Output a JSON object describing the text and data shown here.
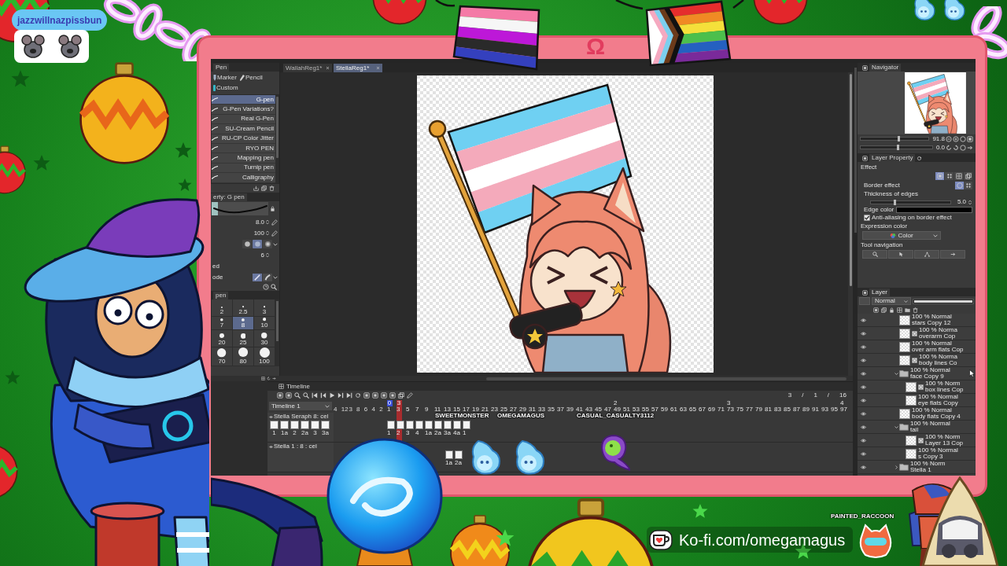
{
  "chat_badge": {
    "username": "jazzwillnazpissbun"
  },
  "banner": {
    "symbol": "Ω"
  },
  "canvas_tabs": [
    {
      "label": "WallahReg1*",
      "selected": false
    },
    {
      "label": "StellaReg1*",
      "selected": true
    }
  ],
  "tool_panel": {
    "tab": "Pen",
    "groups": [
      {
        "label": "Marker",
        "kind": "marker"
      },
      {
        "label": "Pencil",
        "kind": "pencil"
      },
      {
        "label": "Custom",
        "kind": "custom"
      }
    ],
    "brushes": [
      {
        "label": "G-pen",
        "selected": true
      },
      {
        "label": "G-Pen Variations?",
        "selected": false
      },
      {
        "label": "Real G-Pen",
        "selected": false
      },
      {
        "label": "SU-Cream Pencil",
        "selected": false
      },
      {
        "label": "RU-CP Color Jitter",
        "selected": false
      },
      {
        "label": "RYO PEN",
        "selected": false
      },
      {
        "label": "Mapping pen",
        "selected": false
      },
      {
        "label": "Turnip pen",
        "selected": false
      },
      {
        "label": "Calligraphy",
        "selected": false
      }
    ]
  },
  "tool_property": {
    "title": "erty: G pen",
    "rows": [
      {
        "kind": "slider",
        "value": "8.0"
      },
      {
        "kind": "slider",
        "value": "100"
      },
      {
        "kind": "tips",
        "options": [
          {
            "kind": "hard",
            "selected": false
          },
          {
            "kind": "soft",
            "selected": true
          },
          {
            "kind": "blur",
            "selected": false
          }
        ]
      },
      {
        "kind": "number",
        "value": "6"
      },
      {
        "kind": "label",
        "label": "ed"
      },
      {
        "kind": "mode",
        "label": "ode",
        "options": [
          {
            "kind": "pen",
            "selected": true
          },
          {
            "kind": "brush",
            "selected": false
          }
        ]
      }
    ]
  },
  "brush_size": {
    "tab": "pen",
    "sizes": [
      {
        "label": "2",
        "selected": false
      },
      {
        "label": "2.5",
        "selected": false
      },
      {
        "label": "3",
        "selected": false
      },
      {
        "label": "7",
        "selected": false
      },
      {
        "label": "8",
        "selected": true
      },
      {
        "label": "10",
        "selected": false
      },
      {
        "label": "20",
        "selected": false
      },
      {
        "label": "25",
        "selected": false
      },
      {
        "label": "30",
        "selected": false
      },
      {
        "label": "70",
        "selected": false
      },
      {
        "label": "80",
        "selected": false
      },
      {
        "label": "100",
        "selected": false
      }
    ]
  },
  "navigator": {
    "title": "Navigator",
    "zoom": {
      "value": "91.8",
      "level": 0.56
    },
    "rotation": {
      "value": "0.0",
      "level": 0.52
    }
  },
  "layer_property": {
    "title": "Layer Property",
    "section": "Effect",
    "effects": [
      {
        "kind": "border",
        "selected": true
      },
      {
        "kind": "tone",
        "selected": false
      },
      {
        "kind": "pattern",
        "selected": false
      },
      {
        "kind": "extract",
        "selected": false
      }
    ],
    "border_effect": {
      "label": "Border effect",
      "options": [
        {
          "kind": "edge",
          "selected": true
        },
        {
          "kind": "watercolor",
          "selected": false
        }
      ]
    },
    "thickness": {
      "label": "Thickness of edges",
      "value": "5.0",
      "level": 0.3
    },
    "edge_color": {
      "label": "Edge color",
      "color": "#000000"
    },
    "antialias": {
      "label": "Anti-aliasing on border effect",
      "checked": true
    },
    "expression_color": {
      "label": "Expression color",
      "value": "Color"
    },
    "tool_navigation": {
      "label": "Tool navigation",
      "buttons": [
        {
          "kind": "zoom"
        },
        {
          "kind": "object"
        },
        {
          "kind": "points"
        },
        {
          "kind": "arrow"
        }
      ]
    }
  },
  "layer_panel": {
    "tabs": [
      {
        "label": "Layer",
        "selected": true
      }
    ],
    "blend_mode": "Normal",
    "opacity": {
      "level": 1
    },
    "layers": [
      {
        "kind": "raster",
        "mode": "100 % Normal",
        "name": "stars Copy 12"
      },
      {
        "kind": "vector",
        "mode": "100 % Norma",
        "name": "overarm Cop"
      },
      {
        "kind": "raster",
        "mode": "100 % Normal",
        "name": "over arm flats Cop"
      },
      {
        "kind": "vector",
        "mode": "100 % Norma",
        "name": "body lines Co"
      },
      {
        "kind": "folder",
        "mode": "100 % Normal",
        "name": "face Copy 9",
        "expanded": true,
        "children": [
          {
            "kind": "vector",
            "mode": "100 % Norm",
            "name": "box lines Cop"
          },
          {
            "kind": "raster",
            "mode": "100 % Normal",
            "name": "eye flats Copy"
          }
        ]
      },
      {
        "kind": "raster",
        "mode": "100 % Normal",
        "name": "body flats Copy 4"
      },
      {
        "kind": "folder",
        "mode": "100 % Normal",
        "name": "tail",
        "expanded": true,
        "children": [
          {
            "kind": "vector",
            "mode": "100 % Norm",
            "name": "Layer 13 Cop"
          },
          {
            "kind": "raster",
            "mode": "100 % Normal",
            "name": "s Copy 3"
          }
        ]
      },
      {
        "kind": "folder",
        "mode": "100 % Norm",
        "name": "Stella 1",
        "expanded": false
      }
    ]
  },
  "timeline": {
    "title": "Timeline",
    "name": "Timeline 1",
    "counter": [
      "3",
      "/",
      "1",
      "/",
      "16"
    ],
    "ruler_marks": [
      {
        "label": "0",
        "kind": "in"
      },
      {
        "label": "3",
        "kind": "playhead"
      },
      {
        "label": "2",
        "kind": "second"
      },
      {
        "label": "3",
        "kind": "second"
      },
      {
        "label": "4",
        "kind": "second"
      }
    ],
    "lead_numbers": [
      "4",
      "12",
      "3",
      "8",
      "6",
      "4",
      "2"
    ],
    "frame_numbers": [
      "1",
      "3",
      "5",
      "7",
      "9",
      "11",
      "13",
      "15",
      "17",
      "19",
      "21",
      "23",
      "25",
      "27",
      "29",
      "31",
      "33",
      "35",
      "37",
      "39",
      "41",
      "43",
      "45",
      "47",
      "49",
      "51",
      "53",
      "55",
      "57",
      "59",
      "61",
      "63",
      "65",
      "67",
      "69",
      "71",
      "73",
      "75",
      "77",
      "79",
      "81",
      "83",
      "85",
      "87",
      "89",
      "91",
      "93",
      "95",
      "97"
    ],
    "tracks": [
      {
        "name": "Stella Seraph 8: cel",
        "thumbs": [
          "1",
          "1a",
          "2",
          "2a",
          "3",
          "3a"
        ],
        "cels": [
          "1",
          "2",
          "3",
          "4",
          "1a",
          "2a",
          "3a",
          "4a",
          "1"
        ]
      },
      {
        "name": "Stella 1 : 8 : cel",
        "cels": [
          "1a",
          "2a"
        ]
      }
    ]
  },
  "chat_avatars": [
    {
      "name": "SWEETMONSTER",
      "kind": "ghost"
    },
    {
      "name": "OMEGAMAGUS",
      "kind": "ghost"
    },
    {
      "name": "CASUAL_CASUALTY3112",
      "kind": "blob"
    },
    {
      "name": "PAINTED_RACCOON",
      "kind": "raccoon"
    }
  ],
  "kofi": {
    "text": "Ko-fi.com/omegamagus"
  }
}
